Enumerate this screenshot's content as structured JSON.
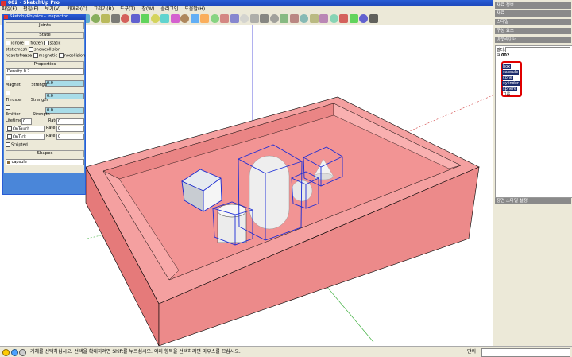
{
  "window": {
    "title": "002 - SketchUp Pro"
  },
  "menu": [
    "파일(F)",
    "편집(E)",
    "보기(V)",
    "카메라(C)",
    "그리기(R)",
    "도구(T)",
    "창(W)",
    "플러그인",
    "도움말(H)"
  ],
  "toolbar_icons": [
    "select-icon",
    "eraser-icon",
    "paint-icon",
    "rectangle-icon",
    "line-icon",
    "circle-icon",
    "push-pull-icon",
    "move-icon",
    "rotate-icon",
    "scale-icon",
    "offset-icon",
    "tape-icon",
    "text-icon",
    "axes-icon",
    "orbit-icon",
    "pan-icon",
    "zoom-icon",
    "zoom-extents-icon",
    "iso-icon",
    "top-icon",
    "front-icon",
    "right-icon",
    "back-icon",
    "left-icon",
    "xray-icon",
    "wireframe-icon",
    "hidden-icon",
    "shaded-icon",
    "textured-icon",
    "mono-icon",
    "section-icon",
    "shadow-icon",
    "fog-icon",
    "edge-icon",
    "record-icon",
    "play-icon",
    "pause-icon",
    "stop-icon"
  ],
  "physics_panel": {
    "title": "SketchyPhysics - Inspector",
    "joints_label": "Joints",
    "state_label": "State",
    "state_options": [
      "ignore",
      "frozen",
      "static",
      "staticmesh",
      "showcollision",
      "noautofreeze",
      "magnetic",
      "nocollision"
    ],
    "properties_label": "Properties",
    "density_label": "Density",
    "density_value": "0.2",
    "magnet_label": "Magnet",
    "magnet_strength_label": "Strength",
    "magnet_strength_value": "0.0",
    "thruster_label": "Thruster",
    "thruster_strength_label": "Strength",
    "thruster_strength_value": "0.0",
    "emitter_label": "Emitter",
    "emitter_strength_label": "Strength",
    "emitter_strength_value": "0.0",
    "lifetime_label": "Lifetime",
    "lifetime_value": "0",
    "lifetime_rate_label": "Rate",
    "lifetime_rate_value": "0",
    "ontouch_label": "OnTouch",
    "ontouch_rate_label": "Rate",
    "ontouch_rate_value": "0",
    "ontick_label": "OnTick",
    "ontick_rate_label": "Rate",
    "ontick_rate_value": "0",
    "scripted_label": "Scripted",
    "shapes_label": "Shapes",
    "shape_value": "capsule"
  },
  "right_panel": {
    "tabs": [
      "재료 정보",
      "재료",
      "스타일",
      "구성 요소",
      "아웃라이너"
    ],
    "filter_label": "필터:",
    "root_label": "002",
    "items": [
      "box",
      "capsule",
      "cone",
      "cylinder",
      "sphere",
      "그룹"
    ],
    "bottom_tab": "장면 스타일 설정"
  },
  "status": {
    "text": "개체를 선택하십시오. 선택을 확대하려면 Shift를 누르십시오. 여러 항목을 선택하려면 마우스를 끄십시오.",
    "unit_label": "단위"
  },
  "colors": {
    "box_wall": "#f08c8c",
    "box_top": "#f4a0a0",
    "box_side": "#e57a7a",
    "selection": "#1a2bd6"
  }
}
